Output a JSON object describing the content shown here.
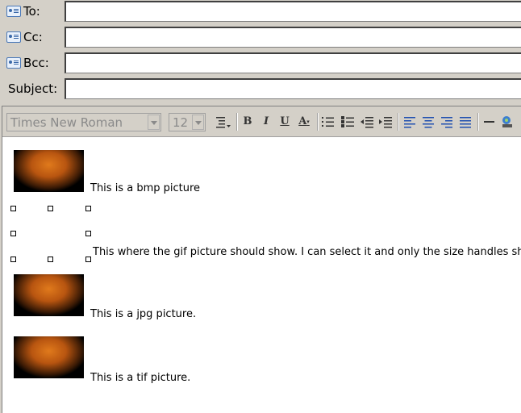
{
  "header": {
    "to_label": "To:",
    "cc_label": "Cc:",
    "bcc_label": "Bcc:",
    "subject_label": "Subject:",
    "to_value": "",
    "cc_value": "",
    "bcc_value": "",
    "subject_value": ""
  },
  "toolbar": {
    "font_name": "Times New Roman",
    "font_size": "12",
    "bold": "B",
    "italic": "I",
    "underline": "U",
    "font_color": "A",
    "icons": [
      "paragraph-style-icon",
      "bold-icon",
      "italic-icon",
      "underline-icon",
      "font-color-icon",
      "numbered-list-icon",
      "bullet-list-icon",
      "decrease-indent-icon",
      "increase-indent-icon",
      "align-left-icon",
      "align-center-icon",
      "align-right-icon",
      "justify-icon",
      "horizontal-line-icon",
      "insert-picture-icon"
    ]
  },
  "content": {
    "bmp_caption": "This is a bmp picture",
    "gif_caption": "This where the gif picture should show. I can select it and only the size handles show.",
    "jpg_caption": "This is a jpg picture.",
    "tif_caption": "This is a tif picture."
  }
}
